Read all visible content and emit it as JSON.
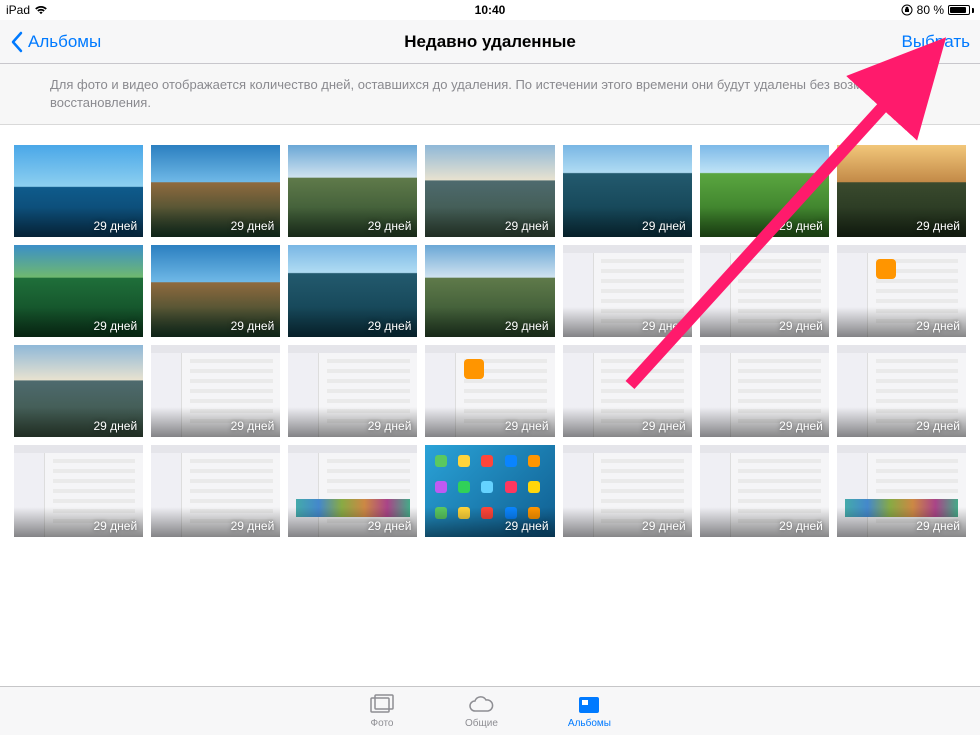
{
  "status": {
    "device": "iPad",
    "time": "10:40",
    "battery_pct": "80 %"
  },
  "nav": {
    "back_label": "Альбомы",
    "title": "Недавно удаленные",
    "select_label": "Выбрать"
  },
  "banner": {
    "text": "Для фото и видео отображается количество дней, оставшихся до удаления. По истечении этого времени они будут удалены без возможности восстановления."
  },
  "thumbnails": {
    "days_label": "29 дней",
    "items": [
      {
        "kind": "sky1"
      },
      {
        "kind": "sky2"
      },
      {
        "kind": "mtn1"
      },
      {
        "kind": "mtn2"
      },
      {
        "kind": "lake"
      },
      {
        "kind": "field"
      },
      {
        "kind": "sunset"
      },
      {
        "kind": "green"
      },
      {
        "kind": "sky2"
      },
      {
        "kind": "lake"
      },
      {
        "kind": "mtn1"
      },
      {
        "kind": "screenshot"
      },
      {
        "kind": "screenshot"
      },
      {
        "kind": "screenshot orange"
      },
      {
        "kind": "mtn2"
      },
      {
        "kind": "screenshot"
      },
      {
        "kind": "screenshot"
      },
      {
        "kind": "screenshot orange"
      },
      {
        "kind": "screenshot"
      },
      {
        "kind": "screenshot"
      },
      {
        "kind": "screenshot"
      },
      {
        "kind": "screenshot"
      },
      {
        "kind": "screenshot"
      },
      {
        "kind": "screenshot colorful"
      },
      {
        "kind": "home"
      },
      {
        "kind": "screenshot"
      },
      {
        "kind": "screenshot"
      },
      {
        "kind": "screenshot colorful"
      }
    ]
  },
  "tabs": {
    "photos": "Фото",
    "shared": "Общие",
    "albums": "Альбомы"
  }
}
